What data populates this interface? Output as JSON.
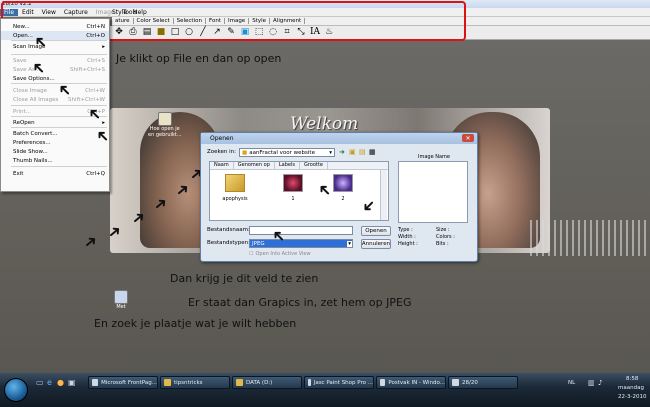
{
  "app": {
    "title": "28/20 v2.2",
    "menu": [
      "File",
      "Edit",
      "View",
      "Capture",
      "Image",
      "Tools"
    ],
    "menu2": [
      "Style",
      "Help"
    ],
    "tabs": [
      "ature",
      "Color Select",
      "Selection",
      "Font",
      "Image",
      "Style",
      "Alignment"
    ]
  },
  "file_menu": {
    "items": [
      {
        "label": "New...",
        "shortcut": "Ctrl+N",
        "disabled": false
      },
      {
        "label": "Open...",
        "shortcut": "Ctrl+O",
        "disabled": false
      },
      {
        "label": "Scan Image",
        "shortcut": "▸",
        "disabled": false
      },
      {
        "label": "Save",
        "shortcut": "Ctrl+S",
        "disabled": true
      },
      {
        "label": "Save As...",
        "shortcut": "Shift+Ctrl+S",
        "disabled": true
      },
      {
        "label": "Save Options...",
        "shortcut": "",
        "disabled": false
      },
      {
        "label": "Close Image",
        "shortcut": "Ctrl+W",
        "disabled": true
      },
      {
        "label": "Close All Images",
        "shortcut": "Shift+Ctrl+W",
        "disabled": true
      },
      {
        "label": "Print...",
        "shortcut": "Ctrl+P",
        "disabled": true
      },
      {
        "label": "ReOpen",
        "shortcut": "▸",
        "disabled": false
      },
      {
        "label": "Batch Convert...",
        "shortcut": "",
        "disabled": false
      },
      {
        "label": "Preferences...",
        "shortcut": "",
        "disabled": false
      },
      {
        "label": "Slide Show...",
        "shortcut": "",
        "disabled": false
      },
      {
        "label": "Thumb Nails...",
        "shortcut": "",
        "disabled": false
      },
      {
        "label": "Exit",
        "shortcut": "Ctrl+Q",
        "disabled": false
      }
    ]
  },
  "annotations": {
    "step1": "Je klikt op File en dan op open",
    "step2": "Dan krijg je dit veld te zien",
    "step3": "Er staat dan Grapics in, zet hem op JPEG",
    "step4": "En zoek je plaatje wat je wilt hebben"
  },
  "banner": {
    "title": "Welkom"
  },
  "desktop_icons": [
    {
      "label": "Hoe open je\nen gebruikt..."
    },
    {
      "label": "Met"
    }
  ],
  "open_dialog": {
    "title": "Openen",
    "look_in_label": "Zoeken in:",
    "look_in_value": "aanFractal voor website",
    "columns": [
      "Naam",
      "Genomen op",
      "Labels",
      "Grootte"
    ],
    "files": [
      "apophysis",
      "1",
      "2"
    ],
    "preview_label": "Image Name",
    "filename_label": "Bestandsnaam:",
    "filename_value": "",
    "filetype_label": "Bestandstypen:",
    "filetype_value": "JPEG",
    "open_button": "Openen",
    "cancel_button": "Annuleren",
    "readonly_checkbox": "Open Into Active View",
    "info": {
      "type_label": "Type :",
      "size_label": "Size :",
      "width_label": "Width :",
      "colors_label": "Colors :",
      "height_label": "Height :",
      "bits_label": "Bits :"
    }
  },
  "taskbar": {
    "items": [
      "Microsoft FrontPag...",
      "tipsntricks",
      "DATA (D:)",
      "Jasc Paint Shop Pro ...",
      "Postvak IN - Windo...",
      "28/20"
    ],
    "tray_lang": "NL",
    "time": "8:58",
    "day": "maandag",
    "date": "22-3-2010"
  },
  "colors": {
    "highlight": "#3a6ea5",
    "red_frame": "#dd1111",
    "filetype_select": "#2f6fd6"
  }
}
